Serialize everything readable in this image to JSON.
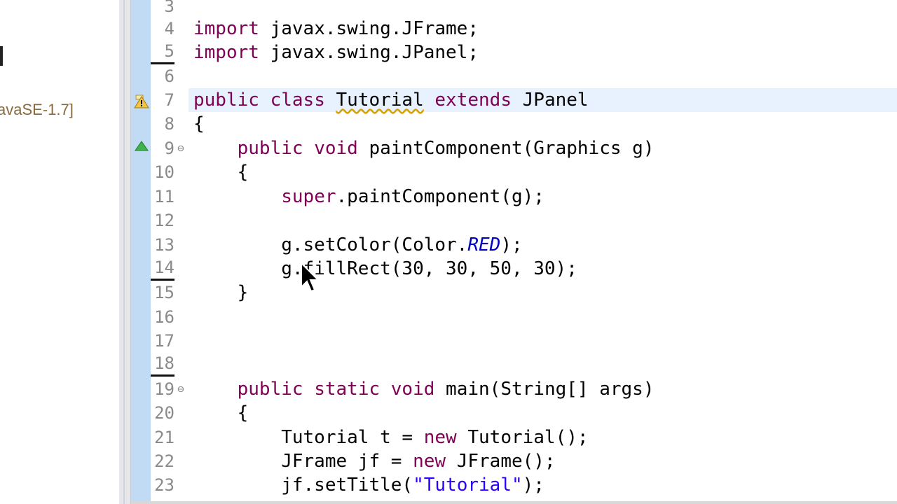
{
  "explorer": {
    "project_label": "avaSE-1.7]"
  },
  "editor": {
    "lines": [
      {
        "num": "3",
        "text": ""
      },
      {
        "num": "4",
        "text": "import javax.swing.JFrame;"
      },
      {
        "num": "5",
        "text": "import javax.swing.JPanel;"
      },
      {
        "num": "6",
        "text": ""
      },
      {
        "num": "7",
        "text": "public class Tutorial extends JPanel"
      },
      {
        "num": "8",
        "text": "{"
      },
      {
        "num": "9",
        "text": "    public void paintComponent(Graphics g)"
      },
      {
        "num": "10",
        "text": "    {"
      },
      {
        "num": "11",
        "text": "        super.paintComponent(g);"
      },
      {
        "num": "12",
        "text": ""
      },
      {
        "num": "13",
        "text": "        g.setColor(Color.RED);"
      },
      {
        "num": "14",
        "text": "        g.fillRect(30, 30, 50, 30);"
      },
      {
        "num": "15",
        "text": "    }"
      },
      {
        "num": "16",
        "text": ""
      },
      {
        "num": "17",
        "text": ""
      },
      {
        "num": "18",
        "text": ""
      },
      {
        "num": "19",
        "text": "    public static void main(String[] args)"
      },
      {
        "num": "20",
        "text": "    {"
      },
      {
        "num": "21",
        "text": "        Tutorial t = new Tutorial();"
      },
      {
        "num": "22",
        "text": "        JFrame jf = new JFrame();"
      },
      {
        "num": "23",
        "text": "        jf.setTitle(\"Tutorial\");"
      }
    ]
  },
  "icons": {
    "fold": "collapse-icon",
    "override": "override-triangle-icon",
    "warning": "warning-icon",
    "cursor": "mouse-pointer-icon"
  },
  "colors": {
    "keyword": "#7f0055",
    "string": "#2a00ff",
    "static_field": "#0000c0",
    "current_line": "#e8f2fe",
    "margin_stripe": "#c0dbf3"
  }
}
